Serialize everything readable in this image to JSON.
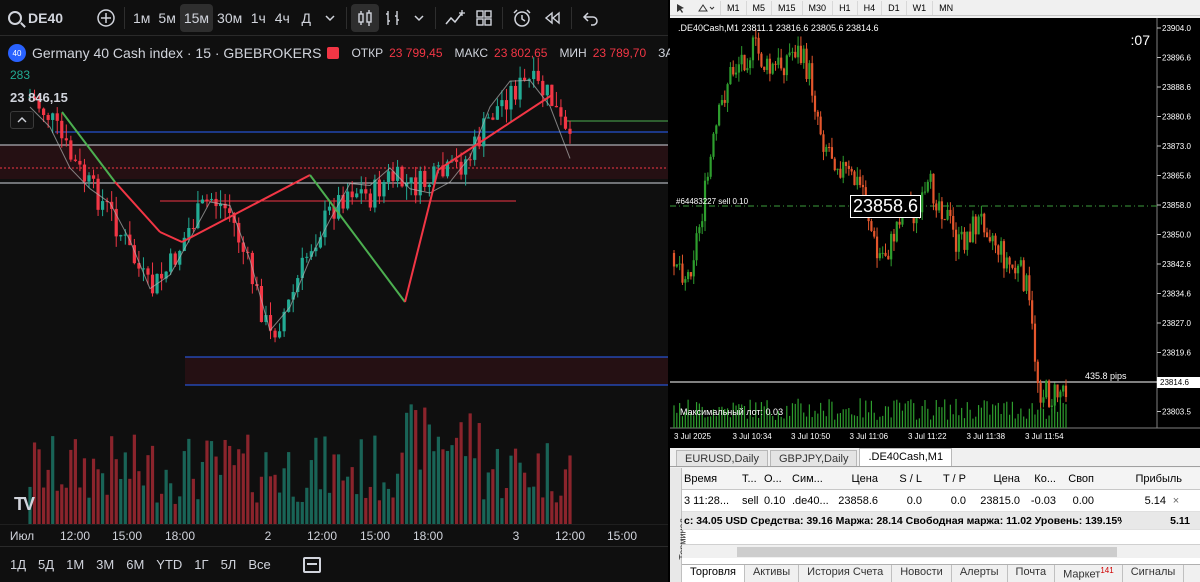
{
  "tv": {
    "symbol": "DE40",
    "toolbar": {
      "timeframes": [
        "1м",
        "5м",
        "15м",
        "30м",
        "1ч",
        "4ч",
        "Д"
      ],
      "active_timeframe": "15м"
    },
    "legend": {
      "flag": "40",
      "title": "Germany 40 Cash index · 15 · GBEBROKERS",
      "open_label": "ОТКР",
      "open": "23 799,45",
      "high_label": "МАКС",
      "high": "23 802,65",
      "low_label": "МИН",
      "low": "23 789,70",
      "close_label": "ЗАКР"
    },
    "volume_value": "283",
    "price_top": "23 846,15",
    "logo": "TV",
    "time_labels": [
      "Июл",
      "12:00",
      "15:00",
      "18:00",
      "2",
      "12:00",
      "15:00",
      "18:00",
      "3",
      "12:00",
      "15:00"
    ],
    "ranges": [
      "1Д",
      "5Д",
      "1М",
      "3М",
      "6М",
      "YTD",
      "1Г",
      "5Л",
      "Все"
    ],
    "colors": {
      "up": "#22ab94",
      "down": "#f23645",
      "zigzag_up": "#f23645",
      "zigzag_down": "#4caf50",
      "level": "#2962ff"
    }
  },
  "mt": {
    "toolbar": {
      "timeframes": [
        "M1",
        "M5",
        "M15",
        "M30",
        "H1",
        "H4",
        "D1",
        "W1",
        "MN"
      ]
    },
    "chart_title": ".DE40Cash,M1  23811.1 23816.6 23805.6 23814.6",
    "timer": ":07",
    "order_label": "#64483227 sell 0.10",
    "order_price": "23858.6",
    "pips": "435.8 pips",
    "max_lot": "Максимальный лот: 0.03",
    "current_price": "23814.6",
    "price_ticks": [
      "23904.0",
      "23896.6",
      "23888.6",
      "23880.6",
      "23873.0",
      "23865.6",
      "23858.0",
      "23850.0",
      "23842.6",
      "23834.6",
      "23827.0",
      "23819.6",
      "23811.5",
      "23803.5"
    ],
    "time_ticks": [
      "3 Jul 2025",
      "3 Jul 10:34",
      "3 Jul 10:50",
      "3 Jul 11:06",
      "3 Jul 11:22",
      "3 Jul 11:38",
      "3 Jul 11:54"
    ],
    "chart_tabs": [
      "EURUSD,Daily",
      "GBPJPY,Daily",
      ".DE40Cash,M1"
    ],
    "active_chart_tab": ".DE40Cash,M1",
    "terminal_label": "Терминал",
    "columns": [
      "Время",
      "Т...",
      "О...",
      "Сим...",
      "Цена",
      "S / L",
      "T / P",
      "Цена",
      "Ко...",
      "Своп",
      "Прибыль"
    ],
    "trade_row": [
      "3 11:28...",
      "sell",
      "0.10",
      ".de40...",
      "23858.6",
      "0.0",
      "0.0",
      "23815.0",
      "-0.03",
      "0.00",
      "5.14"
    ],
    "summary": "с: 34.05 USD  Средства: 39.16  Маржа: 28.14  Свободная маржа: 11.02  Уровень: 139.15%",
    "summary_profit": "5.11",
    "bottom_tabs": [
      "Торговля",
      "Активы",
      "История Счета",
      "Новости",
      "Алерты",
      "Почта",
      "Маркет",
      "Сигналы"
    ],
    "market_badge": "141"
  }
}
